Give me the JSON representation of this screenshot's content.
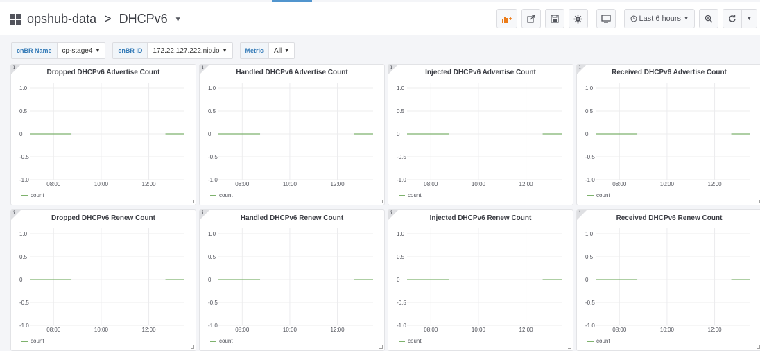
{
  "navbar": {
    "dashboard_folder": "opshub-data",
    "separator": ">",
    "dashboard_title": "DHCPv6",
    "time_picker_label": "Last 6 hours",
    "icons": [
      "add-panel-icon",
      "share-icon",
      "save-icon",
      "settings-icon",
      "tv-mode-icon",
      "clock-icon",
      "zoom-out-icon",
      "refresh-icon",
      "caret-down-icon"
    ]
  },
  "variables": [
    {
      "label": "cnBR Name",
      "value": "cp-stage4"
    },
    {
      "label": "cnBR ID",
      "value": "172.22.127.222.nip.io"
    },
    {
      "label": "Metric",
      "value": "All"
    }
  ],
  "colors": {
    "series_line": "#7eb26d",
    "variable_label": "#337ab7",
    "accent_bar": "#5195ce"
  },
  "panels": [
    {
      "title": "Dropped DHCPv6 Advertise Count"
    },
    {
      "title": "Handled DHCPv6 Advertise Count"
    },
    {
      "title": "Injected DHCPv6 Advertise Count"
    },
    {
      "title": "Received DHCPv6 Advertise Count"
    },
    {
      "title": "Dropped DHCPv6 Renew Count"
    },
    {
      "title": "Handled DHCPv6 Renew Count"
    },
    {
      "title": "Injected DHCPv6 Renew Count"
    },
    {
      "title": "Received DHCPv6 Renew Count"
    }
  ],
  "chart_data": {
    "type": "line",
    "y_ticks": [
      "1.0",
      "0.5",
      "0",
      "-0.5",
      "-1.0"
    ],
    "ylim": [
      -1.0,
      1.0
    ],
    "x_ticks": [
      "08:00",
      "10:00",
      "12:00"
    ],
    "xlim_hours": [
      7.0,
      13.5
    ],
    "grid": true,
    "legend": "bottom-left",
    "series": [
      {
        "name": "count",
        "segments": [
          [
            [
              7.0,
              0
            ],
            [
              8.75,
              0
            ]
          ],
          [
            [
              12.7,
              0
            ],
            [
              13.5,
              0
            ]
          ]
        ]
      }
    ]
  }
}
